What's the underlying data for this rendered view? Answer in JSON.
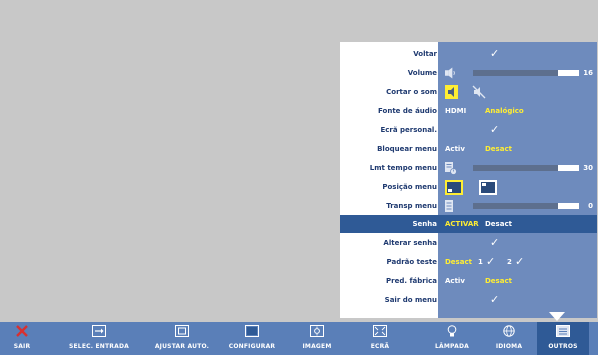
{
  "menu": {
    "rows": [
      {
        "label": "Voltar"
      },
      {
        "label": "Volume",
        "value": "16",
        "level": 0.8
      },
      {
        "label": "Cortar o som"
      },
      {
        "label": "Fonte de áudio",
        "options": [
          "HDMI",
          "Analógico"
        ]
      },
      {
        "label": "Ecrã personal."
      },
      {
        "label": "Bloquear menu",
        "options": [
          "Activ",
          "Desact"
        ]
      },
      {
        "label": "Lmt tempo menu",
        "value": "30",
        "level": 0.8
      },
      {
        "label": "Posição menu"
      },
      {
        "label": "Transp menu",
        "value": "0",
        "level": 0.8
      },
      {
        "label": "Senha",
        "options": [
          "ACTIVAR",
          "Desact"
        ]
      },
      {
        "label": "Alterar senha"
      },
      {
        "label": "Padrão teste",
        "options": [
          "Desact",
          "1",
          "2"
        ]
      },
      {
        "label": "Pred. fábrica",
        "options": [
          "Activ",
          "Desact"
        ]
      },
      {
        "label": "Sair do menu"
      }
    ],
    "selected_index": 9
  },
  "footer": {
    "items": [
      {
        "label": "SAIR",
        "icon": "close-icon"
      },
      {
        "label": "SELEC. ENTRADA",
        "icon": "input-icon"
      },
      {
        "label": "AJUSTAR AUTO.",
        "icon": "auto-adjust-icon"
      },
      {
        "label": "CONFIGURAR",
        "icon": "configure-icon"
      },
      {
        "label": "IMAGEM",
        "icon": "image-icon"
      },
      {
        "label": "ECRÃ",
        "icon": "display-icon"
      },
      {
        "label": "LÂMPADA",
        "icon": "lamp-icon"
      },
      {
        "label": "IDIOMA",
        "icon": "language-icon"
      },
      {
        "label": "OUTROS",
        "icon": "others-icon"
      }
    ],
    "selected_index": 8
  },
  "colors": {
    "panel": "#6e8bbd",
    "highlight": "#2f5a96",
    "active_text": "#ffee33",
    "footer": "#5a7fb8"
  }
}
